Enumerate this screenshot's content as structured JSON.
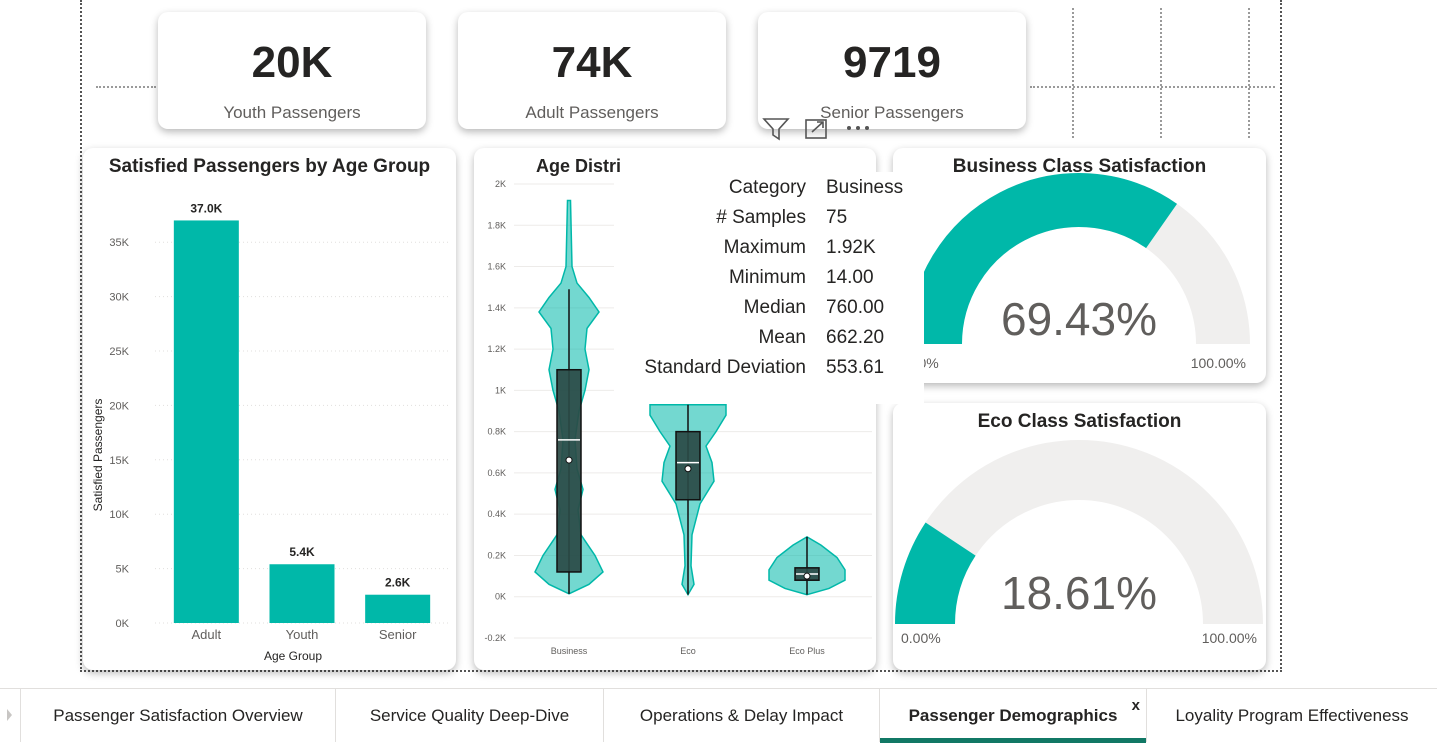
{
  "kpis": [
    {
      "value": "20K",
      "label": "Youth Passengers"
    },
    {
      "value": "74K",
      "label": "Adult Passengers"
    },
    {
      "value": "9719",
      "label": "Senior Passengers"
    }
  ],
  "bar_chart": {
    "title": "Satisfied Passengers by Age Group",
    "ylabel": "Satisfied Passengers",
    "xlabel": "Age Group",
    "yticks": [
      "0K",
      "5K",
      "10K",
      "15K",
      "20K",
      "25K",
      "30K",
      "35K"
    ]
  },
  "violin_chart": {
    "title": "Age Distri",
    "yticks": [
      "-0.2K",
      "0K",
      "0.2K",
      "0.4K",
      "0.6K",
      "0.8K",
      "1K",
      "1.2K",
      "1.4K",
      "1.6K",
      "1.8K",
      "2K"
    ]
  },
  "tooltip": [
    {
      "key": "Category",
      "value": "Business"
    },
    {
      "key": "# Samples",
      "value": "75"
    },
    {
      "key": "Maximum",
      "value": "1.92K"
    },
    {
      "key": "Minimum",
      "value": "14.00"
    },
    {
      "key": "Median",
      "value": "760.00"
    },
    {
      "key": "Mean",
      "value": "662.20"
    },
    {
      "key": "Standard Deviation",
      "value": "553.61"
    }
  ],
  "gauges": [
    {
      "title": "Business Class Satisfaction",
      "value_label": "69.43%",
      "value": 69.43,
      "min_label": "0.00%",
      "max_label": "100.00%"
    },
    {
      "title": "Eco Class Satisfaction",
      "value_label": "18.61%",
      "value": 18.61,
      "min_label": "0.00%",
      "max_label": "100.00%"
    }
  ],
  "tabs": [
    {
      "label": "Passenger Satisfaction Overview",
      "active": false
    },
    {
      "label": "Service Quality Deep-Dive",
      "active": false
    },
    {
      "label": "Operations & Delay Impact",
      "active": false
    },
    {
      "label": "Passenger Demographics",
      "active": true
    },
    {
      "label": "Loyality Program Effectiveness",
      "active": false
    }
  ],
  "tab_close": "x",
  "colors": {
    "accent": "#00b8a9",
    "track": "#f0efee",
    "box": "#2a4a45",
    "active_tab": "#117865"
  },
  "visual_tools": [
    "filter-icon",
    "focus-mode-icon",
    "more-options-icon"
  ],
  "chart_data": [
    {
      "type": "bar",
      "title": "Satisfied Passengers by Age Group",
      "xlabel": "Age Group",
      "ylabel": "Satisfied Passengers",
      "categories": [
        "Adult",
        "Youth",
        "Senior"
      ],
      "values": [
        37000,
        5400,
        2600
      ],
      "data_labels": [
        "37.0K",
        "5.4K",
        "2.6K"
      ],
      "ylim": [
        0,
        37500
      ],
      "grid": true
    },
    {
      "type": "violin",
      "title": "Age Distri",
      "categories": [
        "Business",
        "Eco",
        "Eco Plus"
      ],
      "ylim": [
        -200,
        2000
      ],
      "boxes": [
        {
          "category": "Business",
          "min": 14,
          "q1": 120,
          "median": 760,
          "mean": 662.2,
          "q3": 1100,
          "max": 1920,
          "whisker_high": 1490
        },
        {
          "category": "Eco",
          "min": 10,
          "q1": 470,
          "median": 650,
          "mean": 620,
          "q3": 800,
          "max": 930
        },
        {
          "category": "Eco Plus",
          "min": 10,
          "q1": 80,
          "median": 110,
          "mean": 100,
          "q3": 140,
          "max": 290
        }
      ]
    }
  ]
}
